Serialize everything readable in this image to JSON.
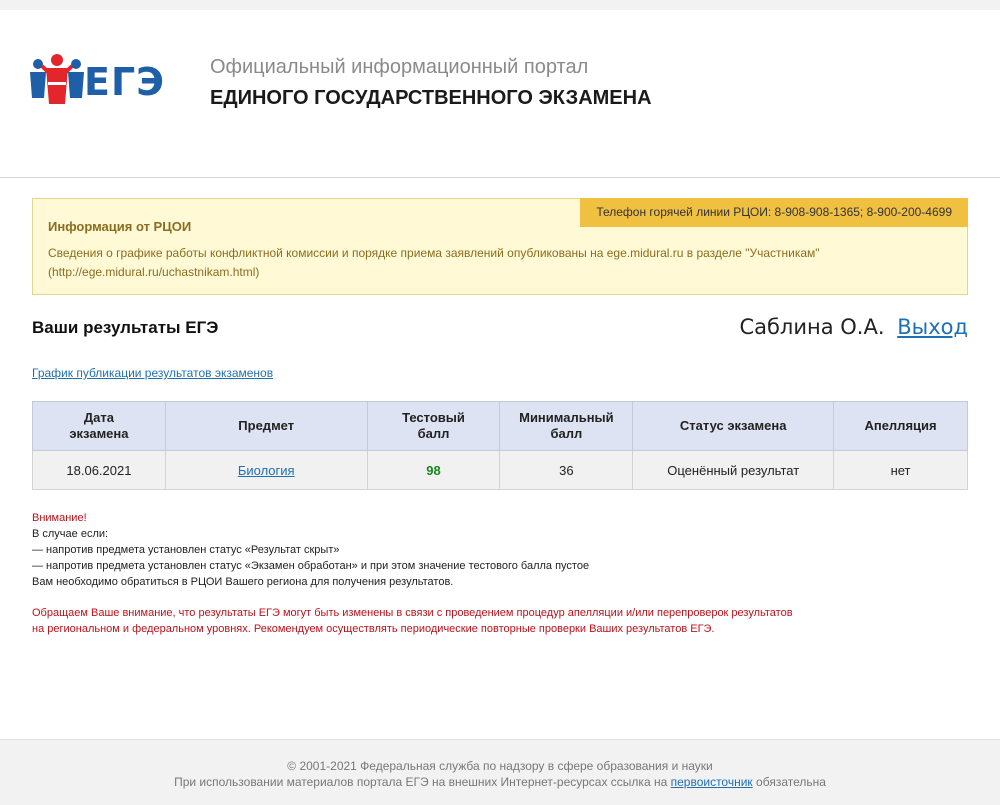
{
  "header": {
    "logo_text": "ЕГЭ",
    "portal_line1": "Официальный информационный портал",
    "portal_line2": "ЕДИНОГО ГОСУДАРСТВЕННОГО ЭКЗАМЕНА"
  },
  "info": {
    "hotline": "Телефон горячей линии РЦОИ: 8-908-908-1365; 8-900-200-4699",
    "title": "Информация от РЦОИ",
    "text_line1": "Сведения о графике работы конфликтной комиссии и порядке приема заявлений опубликованы на ege.midural.ru в разделе \"Участникам\"",
    "text_line2": "(http://ege.midural.ru/uchastnikam.html)"
  },
  "results": {
    "title": "Ваши результаты ЕГЭ",
    "user_name": "Саблина О.А.",
    "logout_label": "Выход",
    "schedule_link": "График публикации результатов экзаменов"
  },
  "table": {
    "headers": {
      "date_line1": "Дата",
      "date_line2": "экзамена",
      "subject": "Предмет",
      "test_line1": "Тестовый",
      "test_line2": "балл",
      "min_line1": "Минимальный",
      "min_line2": "балл",
      "status": "Статус экзамена",
      "appeal": "Апелляция"
    },
    "rows": [
      {
        "date": "18.06.2021",
        "subject": "Биология",
        "test_score": "98",
        "min_score": "36",
        "status": "Оценённый результат",
        "appeal": "нет"
      }
    ]
  },
  "notes": {
    "attention": "Внимание!",
    "case": "В случае если:",
    "item1": "— напротив предмета установлен статус «Результат скрыт»",
    "item2": "— напротив предмета установлен статус «Экзамен обработан» и при этом значение тестового балла пустое",
    "contact": "Вам необходимо обратиться в РЦОИ Вашего региона для получения результатов."
  },
  "notice": {
    "line1": "Обращаем Ваше внимание, что результаты ЕГЭ могут быть изменены в связи с проведением процедур апелляции и/или перепроверок результатов",
    "line2": "на региональном и федеральном уровнях. Рекомендуем осуществлять периодические повторные проверки Ваших результатов ЕГЭ."
  },
  "footer": {
    "copyright": "© 2001-2021 Федеральная служба по надзору в сфере образования и науки",
    "usage_prefix": "При использовании материалов портала ЕГЭ на внешних Интернет-ресурсах ссылка на",
    "usage_link": "первоисточник",
    "usage_suffix": "обязательна"
  },
  "colors": {
    "brand_blue": "#1f5fa8",
    "brand_red": "#e2262b",
    "link": "#1f6fb5",
    "hotline_bg": "#f0c040",
    "info_bg": "#fff9d6",
    "score_green": "#1a8a1a",
    "warning_red": "#c0101a"
  },
  "icons": {
    "logo": "ege-logo-icon"
  }
}
